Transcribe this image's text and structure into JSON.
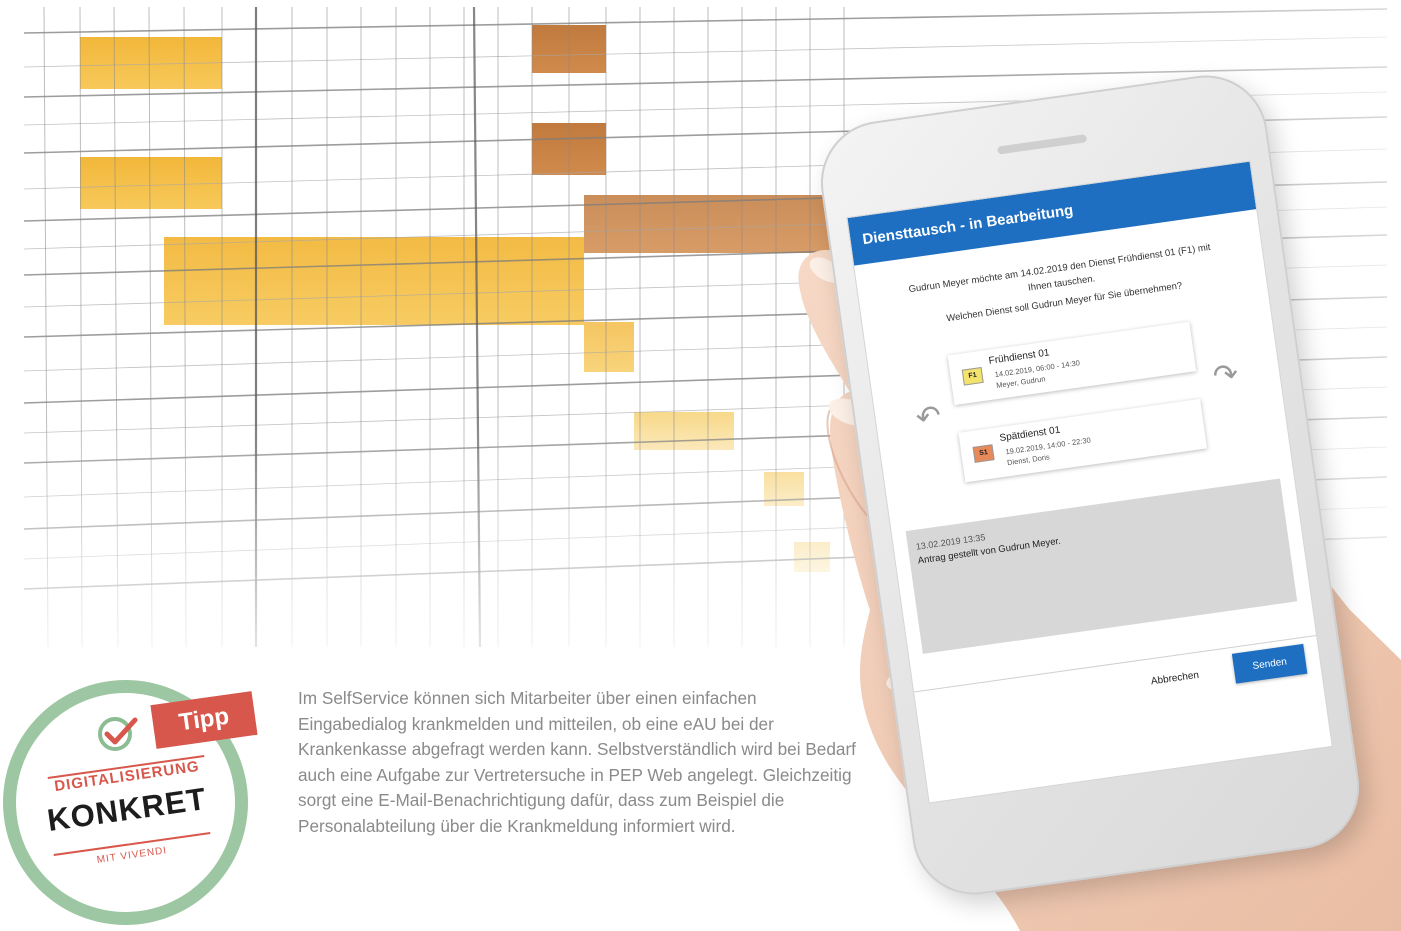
{
  "app": {
    "title": "Diensttausch - in Bearbeitung",
    "request_text": "Gudrun Meyer möchte am 14.02.2019 den Dienst Frühdienst 01 (F1) mit Ihnen tauschen.",
    "question_text": "Welchen Dienst soll Gudrun Meyer für Sie übernehmen?",
    "shifts": [
      {
        "badge": "F1",
        "name": "Frühdienst 01",
        "time": "14.02.2019, 06:00 - 14:30",
        "person": "Meyer, Gudrun",
        "badge_color": "#f3e26b"
      },
      {
        "badge": "S1",
        "name": "Spätdienst 01",
        "time": "19.02.2019, 14:00 - 22:30",
        "person": "Dienst, Doris",
        "badge_color": "#e8895a"
      }
    ],
    "log": {
      "date": "13.02.2019 13:35",
      "message": "Antrag gestellt von Gudrun Meyer."
    },
    "actions": {
      "cancel": "Abbrechen",
      "send": "Senden"
    },
    "colors": {
      "accent": "#1e6fc2",
      "log_background": "#d7d7d7"
    }
  },
  "badge": {
    "tag": "Tipp",
    "line1": "DIGITALISIERUNG",
    "line2": "KONKRET",
    "line3": "MIT VIVENDI",
    "colors": {
      "ring": "#9dc7a2",
      "accent": "#d8574c"
    }
  },
  "caption": "Im SelfService können sich Mitarbeiter über einen einfachen Eingabedialog krankmelden und mitteilen, ob eine eAU bei der Krankenkasse abgefragt werden kann. Selbstverständlich wird bei Bedarf auch eine Aufgabe zur Vertretersuche in PEP Web angelegt. Gleichzeitig sorgt eine E-Mail-Benachrichtigung dafür, dass zum Beispiel die Personalabteilung über die Krankmeldung informiert wird."
}
